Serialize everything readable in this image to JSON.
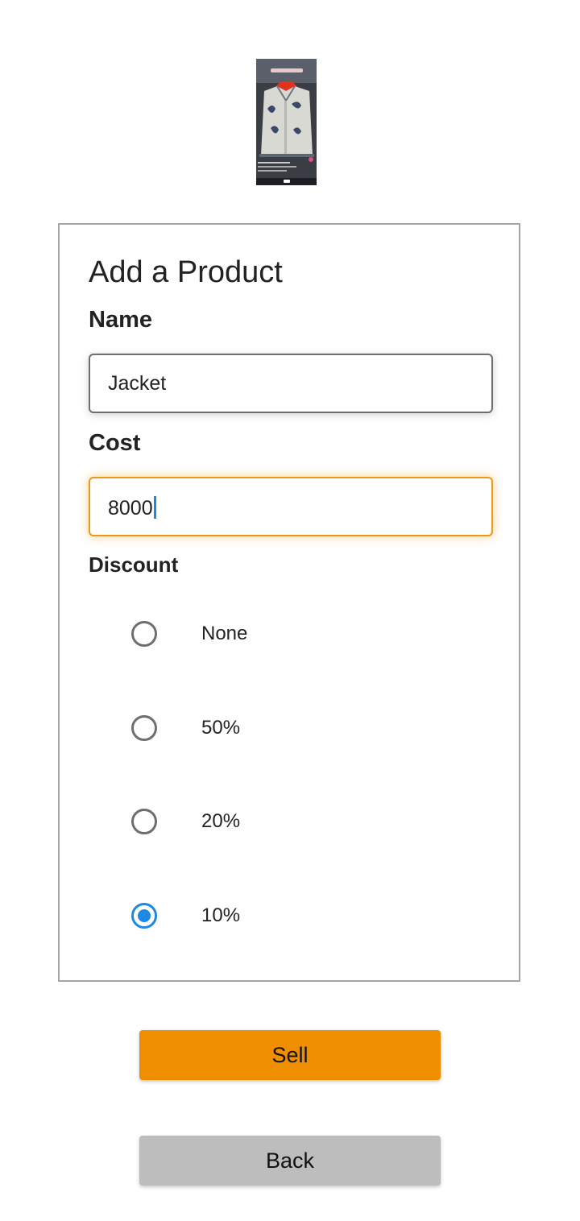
{
  "product_image": {
    "icon": "product-photo-jacket"
  },
  "form": {
    "title": "Add a Product",
    "name": {
      "label": "Name",
      "value": "Jacket"
    },
    "cost": {
      "label": "Cost",
      "value": "8000"
    },
    "discount": {
      "label": "Discount",
      "options": [
        {
          "label": "None",
          "checked": false
        },
        {
          "label": "50%",
          "checked": false
        },
        {
          "label": "20%",
          "checked": false
        },
        {
          "label": "10%",
          "checked": true
        }
      ]
    }
  },
  "actions": {
    "sell_label": "Sell",
    "back_label": "Back"
  },
  "colors": {
    "accent_orange": "#ee8e00",
    "radio_selected": "#1e88e5",
    "back_button": "#bdbdbd",
    "card_border": "#a6a6a6"
  }
}
